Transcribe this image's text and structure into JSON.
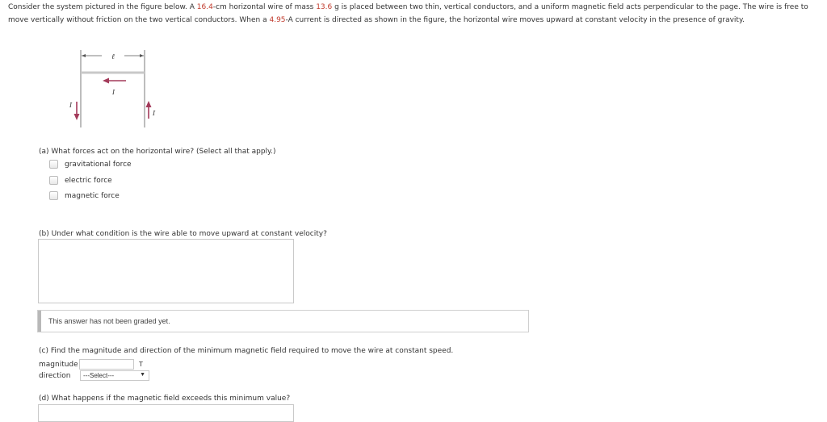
{
  "intro": {
    "part1": "Consider the system pictured in the figure below. A ",
    "length": "16.4",
    "part2": "-cm horizontal wire of mass ",
    "mass": "13.6",
    "part3": " g is placed between two thin, vertical conductors, and a uniform magnetic field acts perpendicular to the page. The wire is free to move vertically without friction on the two vertical conductors. When a ",
    "current": "4.95",
    "part4": "-A current is directed as shown in the figure, the horizontal wire moves upward at constant velocity in the presence of gravity."
  },
  "figure": {
    "length_label": "ℓ",
    "current_label": "I",
    "left_current_label": "I",
    "right_current_label": "I"
  },
  "part_a": {
    "question": "(a) What forces act on the horizontal wire? (Select all that apply.)",
    "options": [
      "gravitational force",
      "electric force",
      "magnetic force"
    ]
  },
  "part_b": {
    "question": "(b) Under what condition is the wire able to move upward at constant velocity?",
    "answer": ""
  },
  "grading": {
    "message": "This answer has not been graded yet."
  },
  "part_c": {
    "question": "(c) Find the magnitude and direction of the minimum magnetic field required to move the wire at constant speed.",
    "magnitude_label": "magnitude",
    "magnitude_value": "",
    "magnitude_unit": "T",
    "direction_label": "direction",
    "direction_selected": "---Select---"
  },
  "part_d": {
    "question": "(d) What happens if the magnetic field exceeds this minimum value?"
  },
  "colors": {
    "highlight": "#c0392b",
    "arrow": "#a33a5a"
  }
}
